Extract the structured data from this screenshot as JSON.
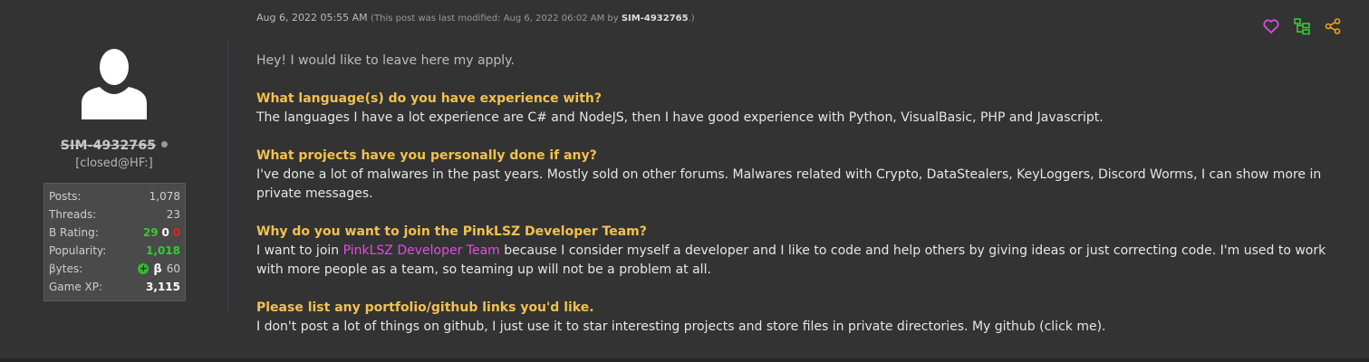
{
  "author": {
    "username": "SIM-4932765",
    "usertitle": "[closed@HF:]",
    "stats": {
      "posts_label": "Posts:",
      "posts_value": "1,078",
      "threads_label": "Threads:",
      "threads_value": "23",
      "brating_label": "B Rating:",
      "brating_pos": "29",
      "brating_neu": "0",
      "brating_neg": "0",
      "popularity_label": "Popularity:",
      "popularity_value": "1,018",
      "bytes_label": "βytes:",
      "bytes_icon": "+",
      "bytes_symbol": "β",
      "bytes_value": "60",
      "gamexp_label": "Game XP:",
      "gamexp_value": "3,115"
    }
  },
  "post": {
    "date": "Aug 6, 2022 05:55 AM",
    "edited_prefix": "(This post was last modified: Aug 6, 2022 06:02 AM by",
    "editor": "SIM-4932765",
    "edited_suffix": ".)",
    "intro": "Hey! I would like to leave here my apply.",
    "q1": "What language(s) do you have experience with?",
    "a1": "The languages I have a lot experience are C# and NodeJS, then I have good experience with Python, VisualBasic, PHP and Javascript.",
    "q2": "What projects have you personally done if any?",
    "a2": "I've done a lot of malwares in the past years. Mostly sold on other forums. Malwares related with Crypto, DataStealers, KeyLoggers, Discord Worms, I can show more in private messages.",
    "q3": "Why do you want to join the PinkLSZ Developer Team?",
    "a3_before": "I want to join ",
    "a3_link": "PinkLSZ Developer Team",
    "a3_after": " because I consider myself a developer and I like to code and help others by giving ideas or just correcting code. I'm used to work with more people as a team, so teaming up will not be a problem at all.",
    "q4": "Please list any portfolio/github links you'd like.",
    "a4": "I don't post a lot of things on github, I just use it to star interesting projects and store files in private directories. My github (click me)."
  },
  "colors": {
    "question": "#f2c14e",
    "link": "#e24ee0",
    "like_icon": "#e24ee0",
    "tree_icon": "#33cc33",
    "share_icon": "#f0a020"
  },
  "icons": [
    "user-avatar-icon",
    "heart-icon",
    "thread-tree-icon",
    "share-icon"
  ]
}
